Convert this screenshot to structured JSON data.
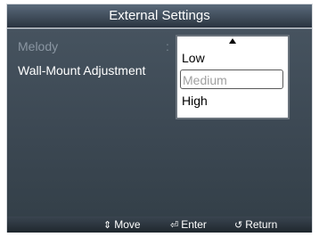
{
  "title": "External Settings",
  "menu": {
    "items": [
      {
        "label": "Melody",
        "dim": true
      },
      {
        "label": "Wall-Mount Adjustment",
        "dim": false
      }
    ],
    "separator": ":"
  },
  "dropdown": {
    "options": [
      "Low",
      "Medium",
      "High"
    ],
    "highlighted": "Medium"
  },
  "footer": {
    "move": {
      "icon": "up-down-arrow-icon",
      "glyph": "⇕",
      "label": "Move"
    },
    "enter": {
      "icon": "enter-icon",
      "glyph": "⏎",
      "label": "Enter"
    },
    "return": {
      "icon": "return-icon",
      "glyph": "↺",
      "label": "Return"
    }
  }
}
